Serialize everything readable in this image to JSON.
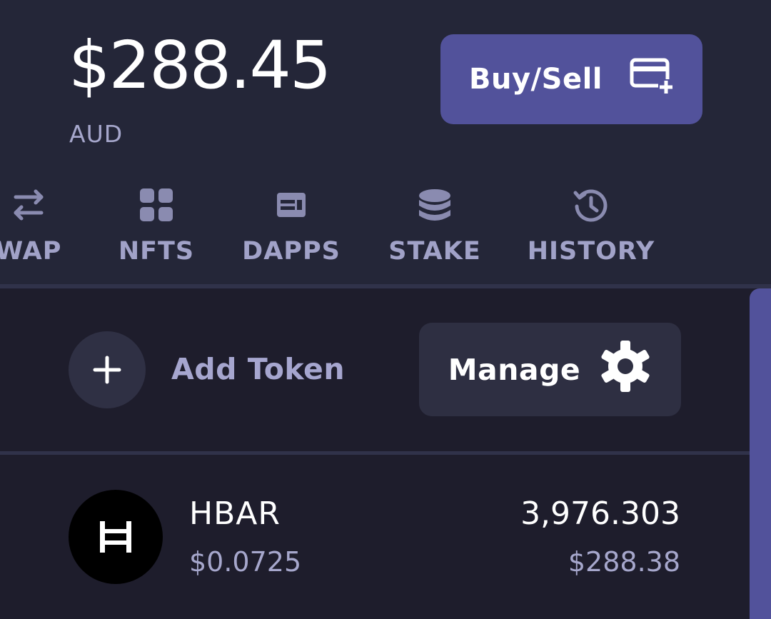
{
  "header": {
    "balance": "$288.45",
    "currency": "AUD",
    "buy_sell_label": "Buy/Sell"
  },
  "nav": {
    "items": [
      {
        "label": "WAP",
        "icon": "swap-arrows-icon"
      },
      {
        "label": "NFTS",
        "icon": "grid-icon"
      },
      {
        "label": "DAPPS",
        "icon": "dapps-icon"
      },
      {
        "label": "STAKE",
        "icon": "coins-stack-icon"
      },
      {
        "label": "HISTORY",
        "icon": "history-icon"
      }
    ]
  },
  "actions": {
    "add_token_label": "Add Token",
    "manage_label": "Manage"
  },
  "tokens": [
    {
      "symbol": "HBAR",
      "price": "$0.0725",
      "amount": "3,976.303",
      "value": "$288.38",
      "icon": "hedera-logo-icon"
    }
  ],
  "colors": {
    "background": "#242638",
    "list_background": "#1e1d2c",
    "accent": "#52529b",
    "muted_text": "#a6a7cc"
  }
}
